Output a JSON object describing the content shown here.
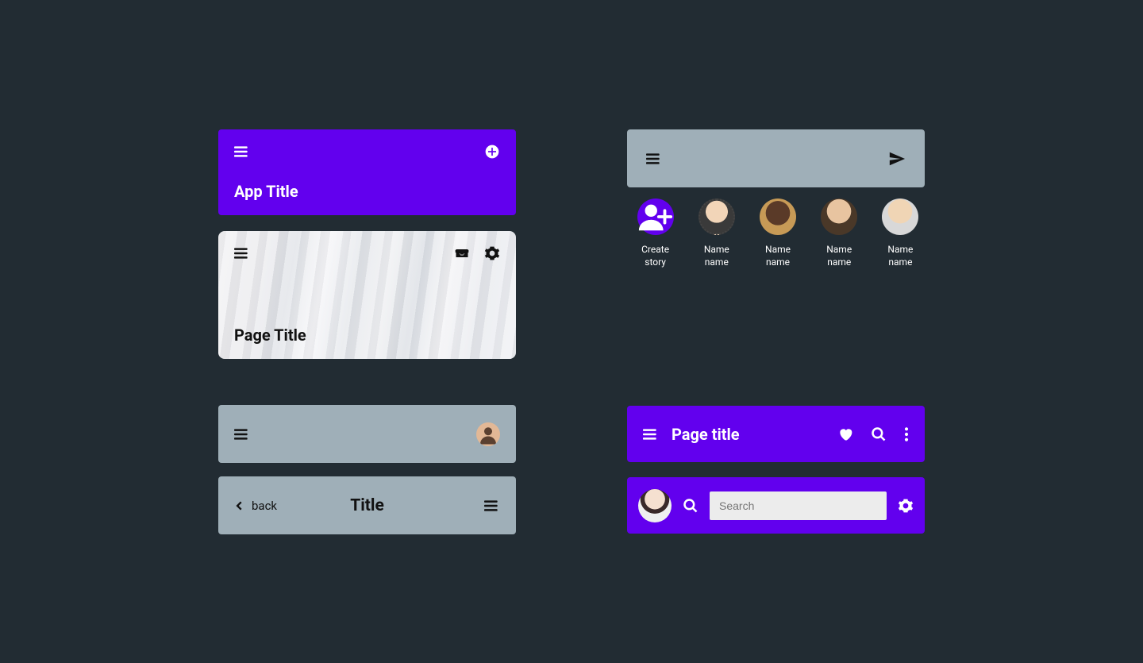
{
  "card1": {
    "title": "App Title"
  },
  "card2": {
    "title": "Page Title"
  },
  "card4": {
    "back_label": "back",
    "title": "Title"
  },
  "stories": {
    "create_line1": "Create",
    "create_line2": "story",
    "items": [
      {
        "line1": "Name",
        "line2": "name"
      },
      {
        "line1": "Name",
        "line2": "name"
      },
      {
        "line1": "Name",
        "line2": "name"
      },
      {
        "line1": "Name",
        "line2": "name"
      }
    ]
  },
  "card6": {
    "title": "Page title"
  },
  "card7": {
    "search_placeholder": "Search"
  }
}
